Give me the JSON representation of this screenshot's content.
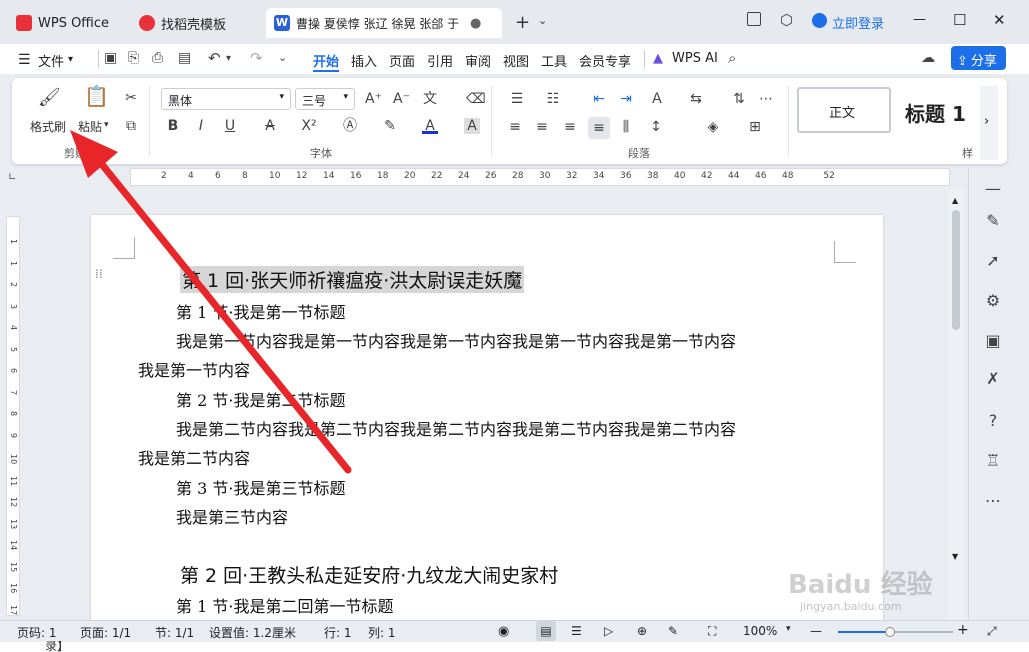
{
  "tabs": [
    {
      "label": "WPS Office"
    },
    {
      "label": "找稻壳模板"
    },
    {
      "label": "曹操 夏侯惇 张辽 徐晃 张郃 于"
    }
  ],
  "window_controls": {
    "login": "立即登录",
    "minimize": "—",
    "maximize": "☐",
    "close": "✕"
  },
  "menu": {
    "file": "文件",
    "items": [
      "开始",
      "插入",
      "页面",
      "引用",
      "审阅",
      "视图",
      "工具",
      "会员专享"
    ],
    "ai": "WPS AI",
    "share": "分享"
  },
  "ribbon": {
    "format_painter": "格式刷",
    "paste": "粘贴",
    "clipboard_group": "剪贴板",
    "font_name": "黑体",
    "font_size": "三号",
    "font_group": "字体",
    "paragraph_group": "段落",
    "style_normal": "正文",
    "style_heading": "标题 1",
    "styles_group": "样"
  },
  "ruler": {
    "ticks": [
      "2",
      "4",
      "6",
      "8",
      "10",
      "12",
      "14",
      "16",
      "18",
      "20",
      "22",
      "24",
      "26",
      "28",
      "30",
      "32",
      "34",
      "36",
      "38",
      "40",
      "42",
      "44",
      "46",
      "48",
      "52"
    ]
  },
  "vruler": {
    "ticks": [
      "1",
      "1",
      "2",
      "3",
      "4",
      "5",
      "6",
      "7",
      "8",
      "9",
      "10",
      "11",
      "12",
      "13",
      "14",
      "15",
      "16",
      "17"
    ]
  },
  "document": {
    "lines": [
      "第 1 回·张天师祈禳瘟疫·洪太尉误走妖魔",
      "第 1 节·我是第一节标题",
      "我是第一节内容我是第一节内容我是第一节内容我是第一节内容我是第一节内容",
      "我是第一节内容",
      "第 2 节·我是第二节标题",
      "我是第二节内容我是第二节内容我是第二节内容我是第二节内容我是第二节内容",
      "我是第二节内容",
      "第 3 节·我是第三节标题",
      "我是第三节内容",
      "",
      "第 2 回·王教头私走延安府·九纹龙大闹史家村",
      "第 1 节·我是第二回第一节标题"
    ]
  },
  "status": {
    "page_num": "页码: 1",
    "pages": "页面: 1/1",
    "section": "节: 1/1",
    "setting": "设置值: 1.2厘米",
    "row": "行: 1",
    "col": "列: 1",
    "zoom": "100%"
  },
  "watermark": {
    "line1": "Baidu 经验",
    "line2": "jingyan.baidu.com"
  },
  "bottom_fragment": "录】",
  "colors": {
    "accent": "#1c6fe8",
    "arrow": "#e8262a",
    "wps_red": "#e8313a"
  }
}
